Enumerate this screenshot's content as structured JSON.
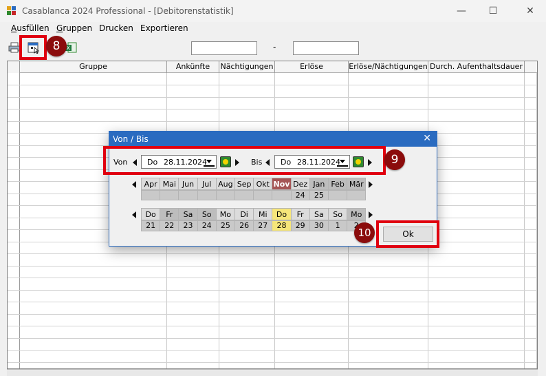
{
  "window": {
    "title": "Casablanca 2024 Professional - [Debitorenstatistik]",
    "minimize": "—",
    "maximize": "☐",
    "close": "✕"
  },
  "menu": {
    "items": [
      {
        "first": "A",
        "rest": "usfüllen"
      },
      {
        "first": "G",
        "rest": "ruppen"
      },
      {
        "first": "",
        "rest": "Drucken"
      },
      {
        "first": "",
        "rest": "Exportieren"
      }
    ]
  },
  "toolbar": {
    "from_value": "",
    "to_value": "",
    "separator": "-"
  },
  "badges": {
    "b8": "8",
    "b9": "9",
    "b10": "10"
  },
  "grid": {
    "columns": [
      "Gruppe",
      "Ankünfte",
      "Nächtigungen",
      "Erlöse",
      "Erlöse/Nächtigungen",
      "Durch. Aufenthaltsdauer"
    ]
  },
  "dialog": {
    "title": "Von / Bis",
    "close": "✕",
    "von_label": "Von",
    "bis_label": "Bis",
    "von_day": "Do",
    "von_date": "28.11.2024",
    "bis_day": "Do",
    "bis_date": "28.11.2024",
    "months": [
      "Apr",
      "Mai",
      "Jun",
      "Jul",
      "Aug",
      "Sep",
      "Okt",
      "Nov",
      "Dez",
      "Jan",
      "Feb",
      "Mär"
    ],
    "month_numbers": [
      "",
      "",
      "",
      "",
      "",
      "",
      "",
      "",
      "24",
      "25",
      "",
      ""
    ],
    "weekdays": [
      "Do",
      "Fr",
      "Sa",
      "So",
      "Mo",
      "Di",
      "Mi",
      "Do",
      "Fr",
      "Sa",
      "So",
      "Mo"
    ],
    "days": [
      "21",
      "22",
      "23",
      "24",
      "25",
      "26",
      "27",
      "28",
      "29",
      "30",
      "1",
      "2"
    ],
    "ok": "Ok"
  },
  "colors": {
    "accent": "#2a6bc0",
    "highlight_box": "#e0000f",
    "badge": "#8b0c0c",
    "selected_month": "#a55555",
    "selected_day": "#f6e67a"
  }
}
